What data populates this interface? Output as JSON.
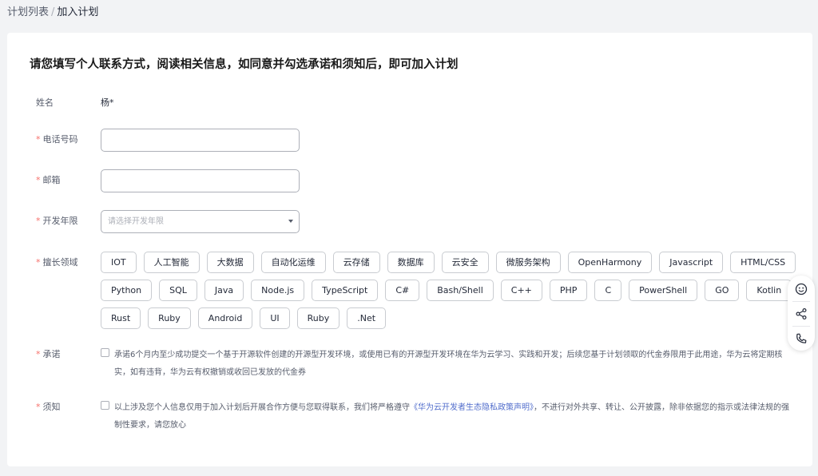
{
  "breadcrumb": {
    "parent": "计划列表",
    "separator": "/",
    "current": "加入计划"
  },
  "form": {
    "heading": "请您填写个人联系方式，阅读相关信息，如同意并勾选承诺和须知后，即可加入计划",
    "name": {
      "label": "姓名",
      "value": "杨*"
    },
    "phone": {
      "label": "电话号码",
      "value": "",
      "placeholder": ""
    },
    "email": {
      "label": "邮箱",
      "value": "",
      "placeholder": ""
    },
    "years": {
      "label": "开发年限",
      "placeholder": "请选择开发年限"
    },
    "expertise": {
      "label": "擅长领域",
      "rows": [
        [
          "IOT",
          "人工智能",
          "大数据",
          "自动化运维",
          "云存储",
          "数据库",
          "云安全",
          "微服务架构",
          "OpenHarmony",
          "Javascript",
          "HTML/CSS"
        ],
        [
          "Python",
          "SQL",
          "Java",
          "Node.js",
          "TypeScript",
          "C#",
          "Bash/Shell",
          "C++",
          "PHP",
          "C",
          "PowerShell",
          "GO",
          "Kotlin"
        ],
        [
          "Rust",
          "Ruby",
          "Android",
          "UI",
          "Ruby",
          ".Net"
        ]
      ]
    },
    "pledge": {
      "label": "承诺",
      "text": "承诺6个月内至少成功提交一个基于开源软件创建的开源型开发环境，或使用已有的开源型开发环境在华为云学习、实践和开发；后续您基于计划领取的代金券限用于此用途，华为云将定期核实，如有违背，华为云有权撤销或收回已发放的代金券",
      "checked": false
    },
    "notice": {
      "label": "须知",
      "text_before": "以上涉及您个人信息仅用于加入计划后开展合作方便与您取得联系，我们将严格遵守",
      "link": "《华为云开发者生态隐私政策声明》",
      "text_after": "，不进行对外共享、转让、公开披露，除非依据您的指示或法律法规的强制性要求，请您放心",
      "checked": false
    },
    "required_mark": "*"
  },
  "floatbar": {
    "icons": [
      "smile-icon",
      "share-icon",
      "phone-icon"
    ]
  },
  "colors": {
    "required": "#f66f6a",
    "link": "#526ecc",
    "page_bg": "#f2f3f5"
  }
}
